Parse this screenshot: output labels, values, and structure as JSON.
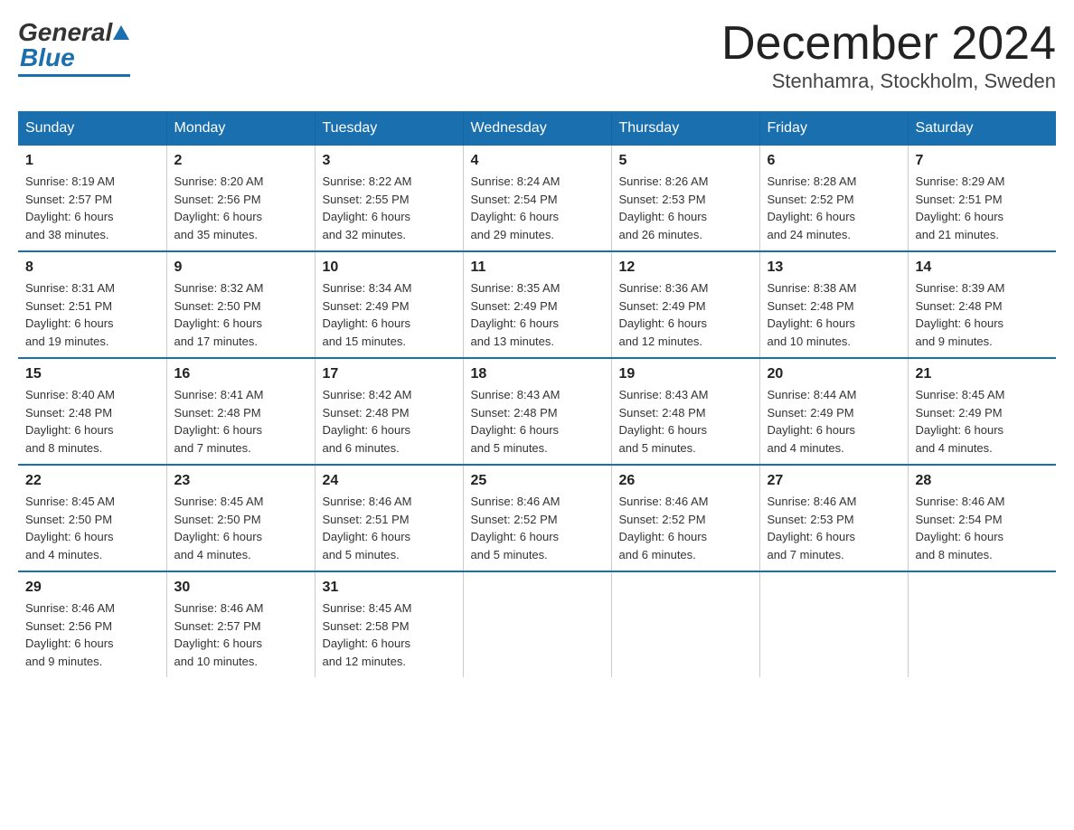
{
  "header": {
    "logo_general": "General",
    "logo_blue": "Blue",
    "month_title": "December 2024",
    "location": "Stenhamra, Stockholm, Sweden"
  },
  "days_of_week": [
    "Sunday",
    "Monday",
    "Tuesday",
    "Wednesday",
    "Thursday",
    "Friday",
    "Saturday"
  ],
  "weeks": [
    [
      {
        "day": "1",
        "sunrise": "Sunrise: 8:19 AM",
        "sunset": "Sunset: 2:57 PM",
        "daylight": "Daylight: 6 hours and 38 minutes."
      },
      {
        "day": "2",
        "sunrise": "Sunrise: 8:20 AM",
        "sunset": "Sunset: 2:56 PM",
        "daylight": "Daylight: 6 hours and 35 minutes."
      },
      {
        "day": "3",
        "sunrise": "Sunrise: 8:22 AM",
        "sunset": "Sunset: 2:55 PM",
        "daylight": "Daylight: 6 hours and 32 minutes."
      },
      {
        "day": "4",
        "sunrise": "Sunrise: 8:24 AM",
        "sunset": "Sunset: 2:54 PM",
        "daylight": "Daylight: 6 hours and 29 minutes."
      },
      {
        "day": "5",
        "sunrise": "Sunrise: 8:26 AM",
        "sunset": "Sunset: 2:53 PM",
        "daylight": "Daylight: 6 hours and 26 minutes."
      },
      {
        "day": "6",
        "sunrise": "Sunrise: 8:28 AM",
        "sunset": "Sunset: 2:52 PM",
        "daylight": "Daylight: 6 hours and 24 minutes."
      },
      {
        "day": "7",
        "sunrise": "Sunrise: 8:29 AM",
        "sunset": "Sunset: 2:51 PM",
        "daylight": "Daylight: 6 hours and 21 minutes."
      }
    ],
    [
      {
        "day": "8",
        "sunrise": "Sunrise: 8:31 AM",
        "sunset": "Sunset: 2:51 PM",
        "daylight": "Daylight: 6 hours and 19 minutes."
      },
      {
        "day": "9",
        "sunrise": "Sunrise: 8:32 AM",
        "sunset": "Sunset: 2:50 PM",
        "daylight": "Daylight: 6 hours and 17 minutes."
      },
      {
        "day": "10",
        "sunrise": "Sunrise: 8:34 AM",
        "sunset": "Sunset: 2:49 PM",
        "daylight": "Daylight: 6 hours and 15 minutes."
      },
      {
        "day": "11",
        "sunrise": "Sunrise: 8:35 AM",
        "sunset": "Sunset: 2:49 PM",
        "daylight": "Daylight: 6 hours and 13 minutes."
      },
      {
        "day": "12",
        "sunrise": "Sunrise: 8:36 AM",
        "sunset": "Sunset: 2:49 PM",
        "daylight": "Daylight: 6 hours and 12 minutes."
      },
      {
        "day": "13",
        "sunrise": "Sunrise: 8:38 AM",
        "sunset": "Sunset: 2:48 PM",
        "daylight": "Daylight: 6 hours and 10 minutes."
      },
      {
        "day": "14",
        "sunrise": "Sunrise: 8:39 AM",
        "sunset": "Sunset: 2:48 PM",
        "daylight": "Daylight: 6 hours and 9 minutes."
      }
    ],
    [
      {
        "day": "15",
        "sunrise": "Sunrise: 8:40 AM",
        "sunset": "Sunset: 2:48 PM",
        "daylight": "Daylight: 6 hours and 8 minutes."
      },
      {
        "day": "16",
        "sunrise": "Sunrise: 8:41 AM",
        "sunset": "Sunset: 2:48 PM",
        "daylight": "Daylight: 6 hours and 7 minutes."
      },
      {
        "day": "17",
        "sunrise": "Sunrise: 8:42 AM",
        "sunset": "Sunset: 2:48 PM",
        "daylight": "Daylight: 6 hours and 6 minutes."
      },
      {
        "day": "18",
        "sunrise": "Sunrise: 8:43 AM",
        "sunset": "Sunset: 2:48 PM",
        "daylight": "Daylight: 6 hours and 5 minutes."
      },
      {
        "day": "19",
        "sunrise": "Sunrise: 8:43 AM",
        "sunset": "Sunset: 2:48 PM",
        "daylight": "Daylight: 6 hours and 5 minutes."
      },
      {
        "day": "20",
        "sunrise": "Sunrise: 8:44 AM",
        "sunset": "Sunset: 2:49 PM",
        "daylight": "Daylight: 6 hours and 4 minutes."
      },
      {
        "day": "21",
        "sunrise": "Sunrise: 8:45 AM",
        "sunset": "Sunset: 2:49 PM",
        "daylight": "Daylight: 6 hours and 4 minutes."
      }
    ],
    [
      {
        "day": "22",
        "sunrise": "Sunrise: 8:45 AM",
        "sunset": "Sunset: 2:50 PM",
        "daylight": "Daylight: 6 hours and 4 minutes."
      },
      {
        "day": "23",
        "sunrise": "Sunrise: 8:45 AM",
        "sunset": "Sunset: 2:50 PM",
        "daylight": "Daylight: 6 hours and 4 minutes."
      },
      {
        "day": "24",
        "sunrise": "Sunrise: 8:46 AM",
        "sunset": "Sunset: 2:51 PM",
        "daylight": "Daylight: 6 hours and 5 minutes."
      },
      {
        "day": "25",
        "sunrise": "Sunrise: 8:46 AM",
        "sunset": "Sunset: 2:52 PM",
        "daylight": "Daylight: 6 hours and 5 minutes."
      },
      {
        "day": "26",
        "sunrise": "Sunrise: 8:46 AM",
        "sunset": "Sunset: 2:52 PM",
        "daylight": "Daylight: 6 hours and 6 minutes."
      },
      {
        "day": "27",
        "sunrise": "Sunrise: 8:46 AM",
        "sunset": "Sunset: 2:53 PM",
        "daylight": "Daylight: 6 hours and 7 minutes."
      },
      {
        "day": "28",
        "sunrise": "Sunrise: 8:46 AM",
        "sunset": "Sunset: 2:54 PM",
        "daylight": "Daylight: 6 hours and 8 minutes."
      }
    ],
    [
      {
        "day": "29",
        "sunrise": "Sunrise: 8:46 AM",
        "sunset": "Sunset: 2:56 PM",
        "daylight": "Daylight: 6 hours and 9 minutes."
      },
      {
        "day": "30",
        "sunrise": "Sunrise: 8:46 AM",
        "sunset": "Sunset: 2:57 PM",
        "daylight": "Daylight: 6 hours and 10 minutes."
      },
      {
        "day": "31",
        "sunrise": "Sunrise: 8:45 AM",
        "sunset": "Sunset: 2:58 PM",
        "daylight": "Daylight: 6 hours and 12 minutes."
      },
      null,
      null,
      null,
      null
    ]
  ]
}
